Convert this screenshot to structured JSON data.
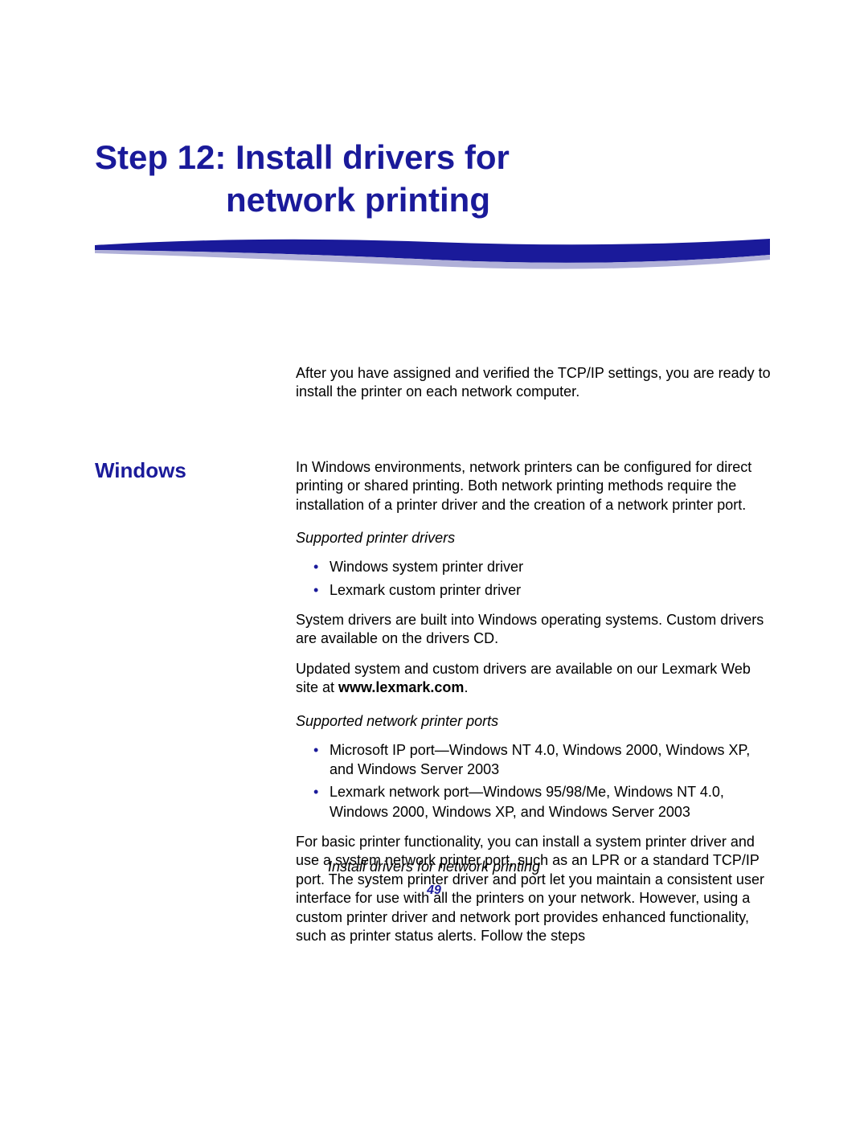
{
  "title": {
    "line1": "Step 12: Install drivers for",
    "line2": "network printing"
  },
  "intro": "After you have assigned and verified the TCP/IP settings, you are ready to install the printer on each network computer.",
  "section": {
    "heading": "Windows",
    "para1": "In Windows environments, network printers can be configured for direct printing or shared printing. Both network printing methods require the installation of a printer driver and the creation of a network printer port.",
    "sub1": "Supported printer drivers",
    "list1": {
      "item1": "Windows system printer driver",
      "item2": "Lexmark custom printer driver"
    },
    "para2": "System drivers are built into Windows operating systems. Custom drivers are available on the drivers CD.",
    "para3_a": "Updated system and custom drivers are available on our Lexmark Web site at ",
    "para3_b": "www.lexmark.com",
    "para3_c": ".",
    "sub2": "Supported network printer ports",
    "list2": {
      "item1": "Microsoft IP port—Windows NT 4.0, Windows 2000, Windows XP, and Windows Server 2003",
      "item2": "Lexmark network port—Windows 95/98/Me, Windows NT 4.0, Windows 2000, Windows XP, and Windows Server 2003"
    },
    "para4": "For basic printer functionality, you can install a system printer driver and use a system network printer port, such as an LPR or a standard TCP/IP port. The system printer driver and port let you maintain a consistent user interface for use with all the printers on your network. However, using a custom printer driver and network port provides enhanced functionality, such as printer status alerts. Follow the steps"
  },
  "footer": {
    "title": "Install drivers for network printing",
    "page": "49"
  },
  "colors": {
    "brand": "#1a1a9a"
  }
}
